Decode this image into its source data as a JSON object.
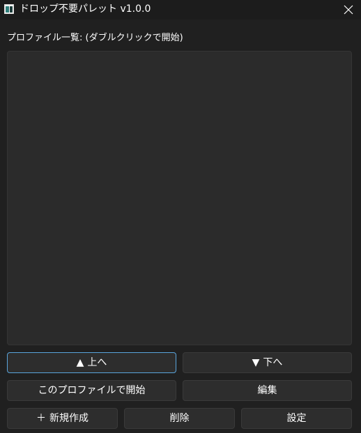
{
  "window": {
    "title": "ドロップ不要パレット v1.0.0"
  },
  "profiles": {
    "label": "プロファイル一覧: (ダブルクリックで開始)",
    "items": []
  },
  "buttons": {
    "up": {
      "icon": "▲",
      "label": "上へ"
    },
    "down": {
      "icon": "▼",
      "label": "下へ"
    },
    "start_profile": {
      "label": "このプロファイルで開始"
    },
    "edit": {
      "label": "編集"
    },
    "new": {
      "icon": "＋",
      "label": "新規作成"
    },
    "delete": {
      "label": "削除"
    },
    "settings": {
      "label": "設定"
    }
  },
  "icons": {
    "app": "window-app-icon",
    "close": "close-icon"
  },
  "colors": {
    "background": "#202020",
    "list_background": "#2b2b2b",
    "button_background": "#2d2d2d",
    "focus_border": "#5aa5dc"
  }
}
